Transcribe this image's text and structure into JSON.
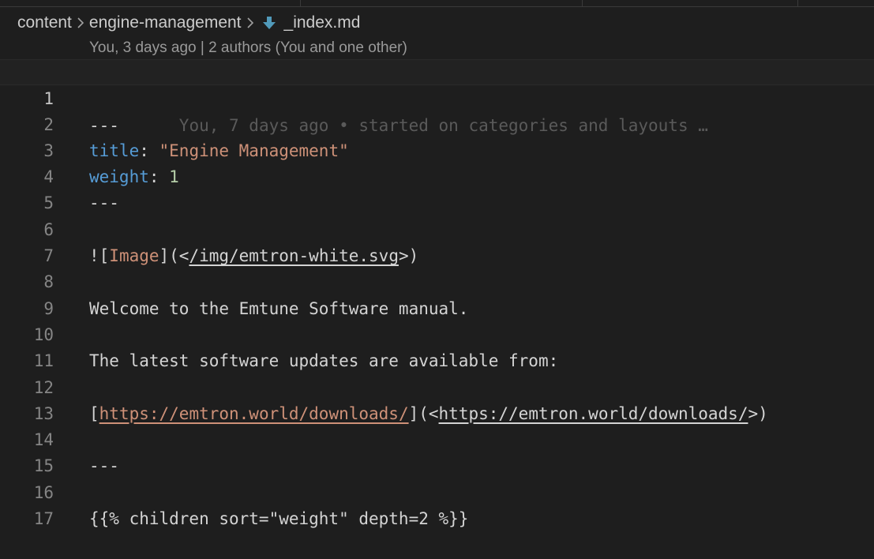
{
  "breadcrumb": {
    "folder1": "content",
    "folder2": "engine-management",
    "file": "_index.md"
  },
  "codelens": "You, 3 days ago | 2 authors (You and one other)",
  "blame": "You, 7 days ago • started on categories and layouts …",
  "colors": {
    "key": "#569cd6",
    "string": "#ce9178",
    "number": "#b5cea8",
    "markdown_icon": "#519aba"
  },
  "lines": {
    "l1": "---",
    "l2_key": "title",
    "l2_colon": ": ",
    "l2_value": "\"Engine Management\"",
    "l3_key": "weight",
    "l3_colon": ": ",
    "l3_value": "1",
    "l4": "---",
    "l6_open": "![",
    "l6_alt": "Image",
    "l6_mid": "](<",
    "l6_url": "/img/emtron-white.svg",
    "l6_close": ">)",
    "l8": "Welcome to the Emtune Software manual.",
    "l10": "The latest software updates are available from:",
    "l12_open": "[",
    "l12_text": "https://emtron.world/downloads/",
    "l12_mid": "](<",
    "l12_url": "https://emtron.world/downloads/",
    "l12_close": ">)",
    "l14": "---",
    "l16": "{{% children sort=\"weight\" depth=2 %}}"
  },
  "line_numbers": [
    "1",
    "2",
    "3",
    "4",
    "5",
    "6",
    "7",
    "8",
    "9",
    "10",
    "11",
    "12",
    "13",
    "14",
    "15",
    "16",
    "17"
  ]
}
